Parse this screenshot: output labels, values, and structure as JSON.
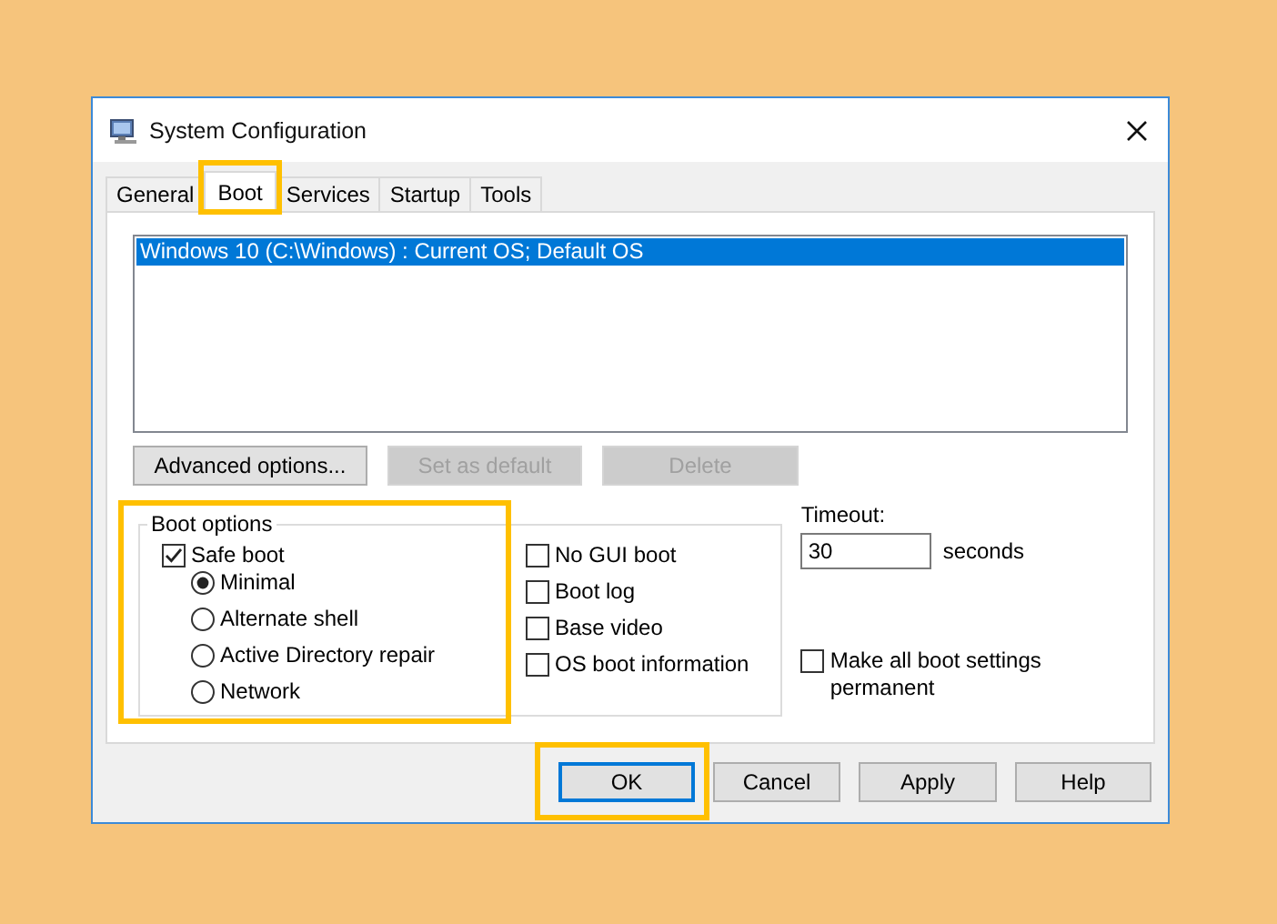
{
  "window": {
    "title": "System Configuration"
  },
  "tabs": [
    {
      "label": "General",
      "selected": false,
      "highlighted": false
    },
    {
      "label": "Boot",
      "selected": true,
      "highlighted": true
    },
    {
      "label": "Services",
      "selected": false,
      "highlighted": false
    },
    {
      "label": "Startup",
      "selected": false,
      "highlighted": false
    },
    {
      "label": "Tools",
      "selected": false,
      "highlighted": false
    }
  ],
  "boot_list": [
    {
      "text": "Windows 10 (C:\\Windows) : Current OS; Default OS",
      "selected": true
    }
  ],
  "list_buttons": [
    {
      "label": "Advanced options...",
      "disabled": false
    },
    {
      "label": "Set as default",
      "disabled": true
    },
    {
      "label": "Delete",
      "disabled": true
    }
  ],
  "boot_options": {
    "title": "Boot options",
    "highlighted": true,
    "safe_boot": {
      "label": "Safe boot",
      "checked": true
    },
    "modes": [
      {
        "label": "Minimal",
        "selected": true
      },
      {
        "label": "Alternate shell",
        "selected": false
      },
      {
        "label": "Active Directory repair",
        "selected": false
      },
      {
        "label": "Network",
        "selected": false
      }
    ],
    "flags": [
      {
        "label": "No GUI boot",
        "checked": false
      },
      {
        "label": "Boot log",
        "checked": false
      },
      {
        "label": "Base video",
        "checked": false
      },
      {
        "label": "OS boot information",
        "checked": false
      }
    ]
  },
  "timeout": {
    "label": "Timeout:",
    "value": "30",
    "unit": "seconds"
  },
  "make_permanent": {
    "label": "Make all boot settings permanent",
    "checked": false
  },
  "buttons": [
    {
      "label": "OK",
      "default": true,
      "highlighted": true
    },
    {
      "label": "Cancel",
      "default": false,
      "highlighted": false
    },
    {
      "label": "Apply",
      "default": false,
      "highlighted": false
    },
    {
      "label": "Help",
      "default": false,
      "highlighted": false
    }
  ]
}
